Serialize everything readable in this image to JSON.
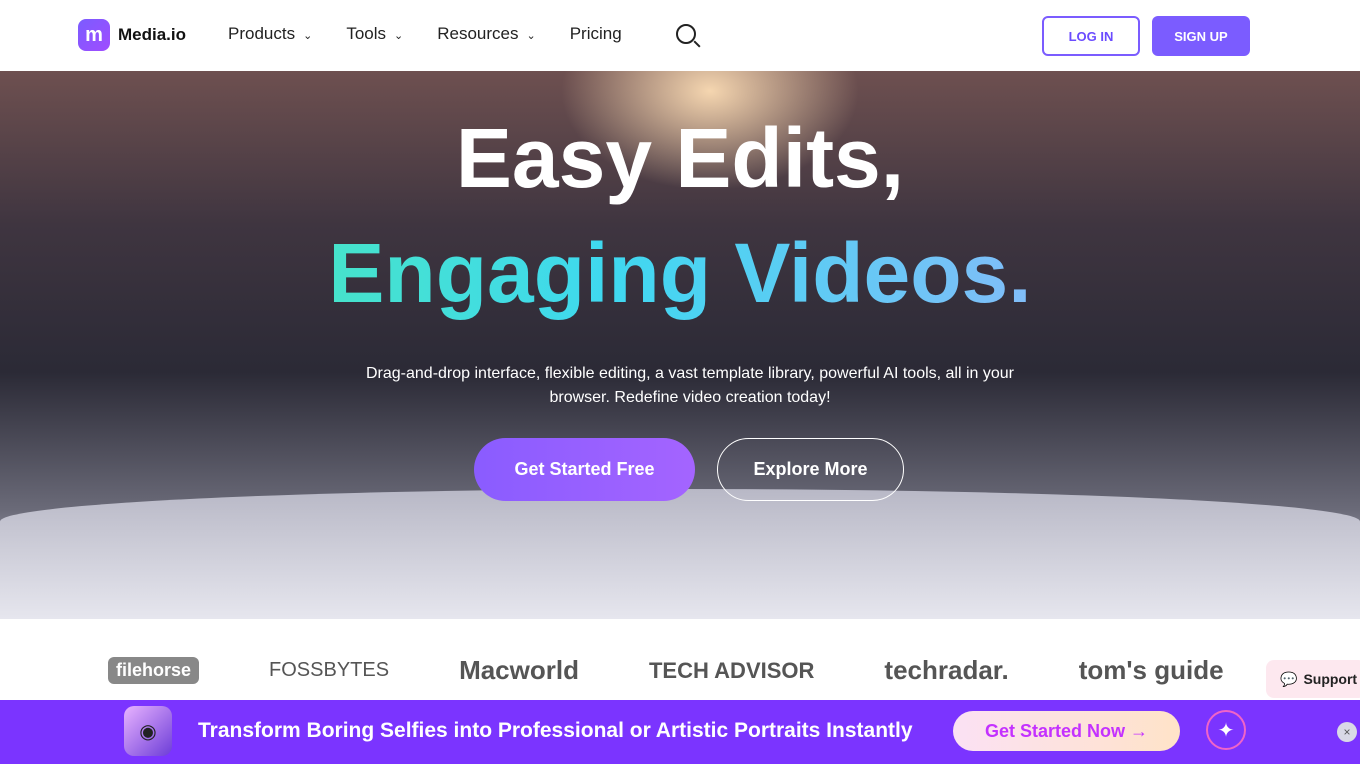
{
  "nav": {
    "logo_mark": "m",
    "brand": "Media.io",
    "items": [
      {
        "label": "Products",
        "chevron": "⌄"
      },
      {
        "label": "Tools",
        "chevron": "⌄"
      },
      {
        "label": "Resources",
        "chevron": "⌄"
      },
      {
        "label": "Pricing"
      }
    ],
    "login": "LOG IN",
    "signup": "SIGN UP"
  },
  "hero": {
    "title_line1": "Easy Edits,",
    "title_line2": "Engaging Videos.",
    "subtitle": "Drag-and-drop interface, flexible editing, a vast template library, powerful AI tools, all in your browser. Redefine video creation today!",
    "cta_primary": "Get Started Free",
    "cta_secondary": "Explore More"
  },
  "press": [
    "filehorse",
    "FOSSBYTES",
    "Macworld",
    "TECH ADVISOR",
    "techradar.",
    "tom's guide"
  ],
  "support": {
    "label": "Support"
  },
  "banner": {
    "text": "Transform Boring Selfies into Professional or Artistic Portraits Instantly",
    "cta": "Get Started Now →",
    "close": "×"
  },
  "colors": {
    "accent": "#7b5cff",
    "banner": "#7b34ff"
  }
}
